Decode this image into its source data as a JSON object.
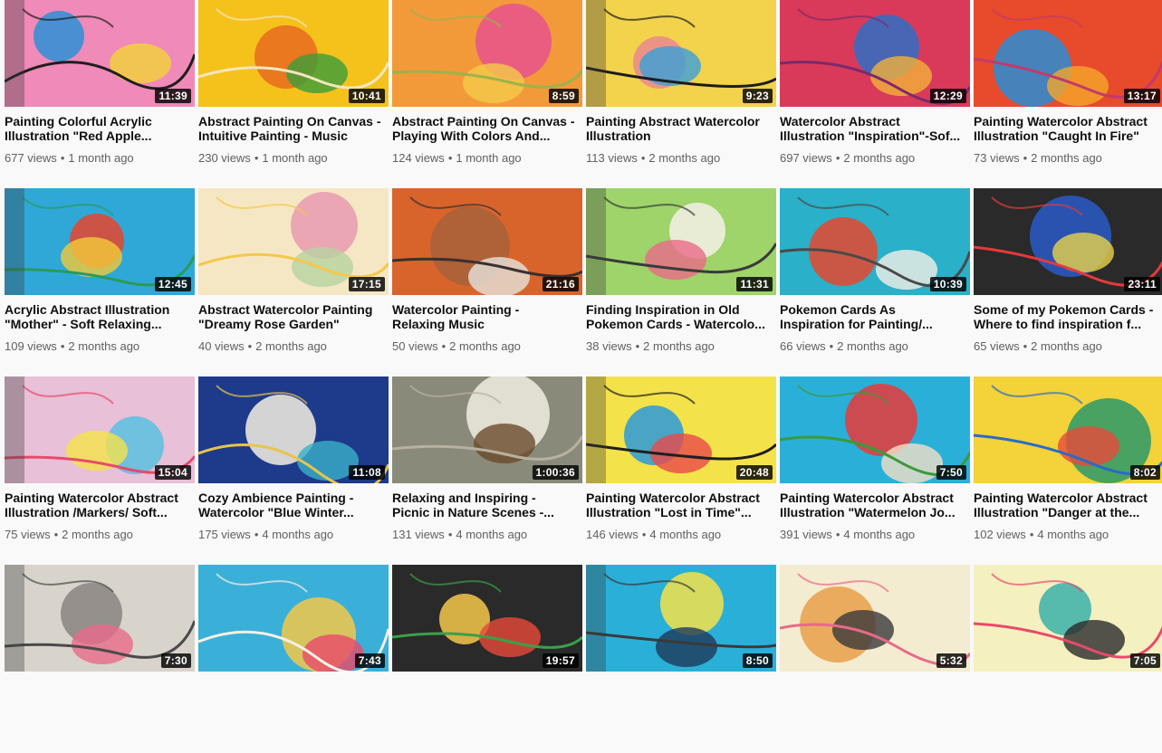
{
  "videos": [
    {
      "title": "Painting Colorful Acrylic Illustration \"Red Apple...",
      "duration": "11:39",
      "views": "677 views",
      "age": "1 month ago",
      "colors": [
        "#f08ab8",
        "#2c8fd6",
        "#f2d33a",
        "#1e1e1e"
      ]
    },
    {
      "title": "Abstract Painting On Canvas - Intuitive Painting - Music",
      "duration": "10:41",
      "views": "230 views",
      "age": "1 month ago",
      "colors": [
        "#f5c21c",
        "#e86b1f",
        "#3b9e3a",
        "#f3e6c0"
      ]
    },
    {
      "title": "Abstract Painting On Canvas - Playing With Colors And...",
      "duration": "8:59",
      "views": "124 views",
      "age": "1 month ago",
      "colors": [
        "#f29a3a",
        "#e8538d",
        "#f4c94a",
        "#9bb34a"
      ]
    },
    {
      "title": "Painting Abstract Watercolor Illustration",
      "duration": "9:23",
      "views": "113 views",
      "age": "2 months ago",
      "colors": [
        "#f3d24c",
        "#e98a8f",
        "#3aa0d8",
        "#1c1c1c"
      ]
    },
    {
      "title": "Watercolor Abstract Illustration \"Inspiration\"-Sof...",
      "duration": "12:29",
      "views": "697 views",
      "age": "2 months ago",
      "colors": [
        "#d93a5a",
        "#2f6fc4",
        "#f0b13a",
        "#7a2a6a"
      ]
    },
    {
      "title": "Painting Watercolor Abstract Illustration \"Caught In Fire\"",
      "duration": "13:17",
      "views": "73 views",
      "age": "2 months ago",
      "colors": [
        "#e84a2c",
        "#2a8cd4",
        "#f4a62a",
        "#c23a6a"
      ]
    },
    {
      "title": "Acrylic Abstract Illustration \"Mother\" - Soft Relaxing...",
      "duration": "12:45",
      "views": "109 views",
      "age": "2 months ago",
      "colors": [
        "#2fa8d8",
        "#e6452e",
        "#f3c93a",
        "#2a9a5a"
      ]
    },
    {
      "title": "Abstract Watercolor Painting \"Dreamy Rose Garden\"",
      "duration": "17:15",
      "views": "40 views",
      "age": "2 months ago",
      "colors": [
        "#f6e7c4",
        "#e89ab0",
        "#b7d3a0",
        "#f4c84a"
      ]
    },
    {
      "title": "Watercolor Painting - Relaxing Music",
      "duration": "21:16",
      "views": "50 views",
      "age": "2 months ago",
      "colors": [
        "#d8642c",
        "#a8603a",
        "#e6e3dc",
        "#3a3030"
      ]
    },
    {
      "title": "Finding Inspiration in Old Pokemon Cards - Watercolo...",
      "duration": "11:31",
      "views": "38 views",
      "age": "2 months ago",
      "colors": [
        "#9ed46a",
        "#f4f0e6",
        "#e86a8a",
        "#3a3a3a"
      ]
    },
    {
      "title": "Pokemon Cards As Inspiration for Painting/...",
      "duration": "10:39",
      "views": "66 views",
      "age": "2 months ago",
      "colors": [
        "#2ab0c8",
        "#e6482e",
        "#f4f0e6",
        "#4a4a4a"
      ]
    },
    {
      "title": "Some of my Pokemon Cards - Where to find inspiration f...",
      "duration": "23:11",
      "views": "65 views",
      "age": "2 months ago",
      "colors": [
        "#2a2a2a",
        "#2a5ac8",
        "#e8d24a",
        "#e63a3a"
      ]
    },
    {
      "title": "Painting Watercolor Abstract Illustration /Markers/ Soft...",
      "duration": "15:04",
      "views": "75 views",
      "age": "2 months ago",
      "colors": [
        "#e8c0d8",
        "#5ac0e0",
        "#f4e24a",
        "#e84a6a"
      ]
    },
    {
      "title": "Cozy Ambience Painting - Watercolor \"Blue Winter...",
      "duration": "11:08",
      "views": "175 views",
      "age": "4 months ago",
      "colors": [
        "#1e3a8a",
        "#f4f0e0",
        "#3ab0c8",
        "#e8c44a"
      ]
    },
    {
      "title": "Relaxing and Inspiring - Picnic in Nature Scenes -...",
      "duration": "1:00:36",
      "views": "131 views",
      "age": "4 months ago",
      "colors": [
        "#8a8a7a",
        "#f0ece2",
        "#6a4a2a",
        "#b8b0a0"
      ]
    },
    {
      "title": "Painting Watercolor Abstract Illustration \"Lost in Time\"...",
      "duration": "20:48",
      "views": "146 views",
      "age": "4 months ago",
      "colors": [
        "#f4e24a",
        "#2a9ad8",
        "#e84a4a",
        "#1e1e1e"
      ]
    },
    {
      "title": "Painting Watercolor Abstract Illustration \"Watermelon Jo...",
      "duration": "7:50",
      "views": "391 views",
      "age": "4 months ago",
      "colors": [
        "#2ab0d8",
        "#e83a3a",
        "#f4e0c8",
        "#3a9a3a"
      ]
    },
    {
      "title": "Painting Watercolor Abstract Illustration \"Danger at the...",
      "duration": "8:02",
      "views": "102 views",
      "age": "4 months ago",
      "colors": [
        "#f4d23a",
        "#2a9a6a",
        "#e84a3a",
        "#2a6ac8"
      ]
    },
    {
      "title": "",
      "duration": "7:30",
      "views": "",
      "age": "",
      "colors": [
        "#d8d4cc",
        "#8a8480",
        "#e86a8a",
        "#4a4a4a"
      ]
    },
    {
      "title": "",
      "duration": "7:43",
      "views": "",
      "age": "",
      "colors": [
        "#3ab0d8",
        "#f4c84a",
        "#e84a6a",
        "#f4f0e6"
      ]
    },
    {
      "title": "",
      "duration": "19:57",
      "views": "",
      "age": "",
      "colors": [
        "#2a2a2a",
        "#f4c84a",
        "#e84a3a",
        "#3aa04a"
      ]
    },
    {
      "title": "",
      "duration": "8:50",
      "views": "",
      "age": "",
      "colors": [
        "#2ab0d8",
        "#f4e24a",
        "#1e3a5a",
        "#3a3a3a"
      ]
    },
    {
      "title": "",
      "duration": "5:32",
      "views": "",
      "age": "",
      "colors": [
        "#f4ecd0",
        "#e8a04a",
        "#3a3a3a",
        "#e86a8a"
      ]
    },
    {
      "title": "",
      "duration": "7:05",
      "views": "",
      "age": "",
      "colors": [
        "#f4f0c0",
        "#3ab0a8",
        "#2a2a2a",
        "#e84a6a"
      ]
    }
  ]
}
